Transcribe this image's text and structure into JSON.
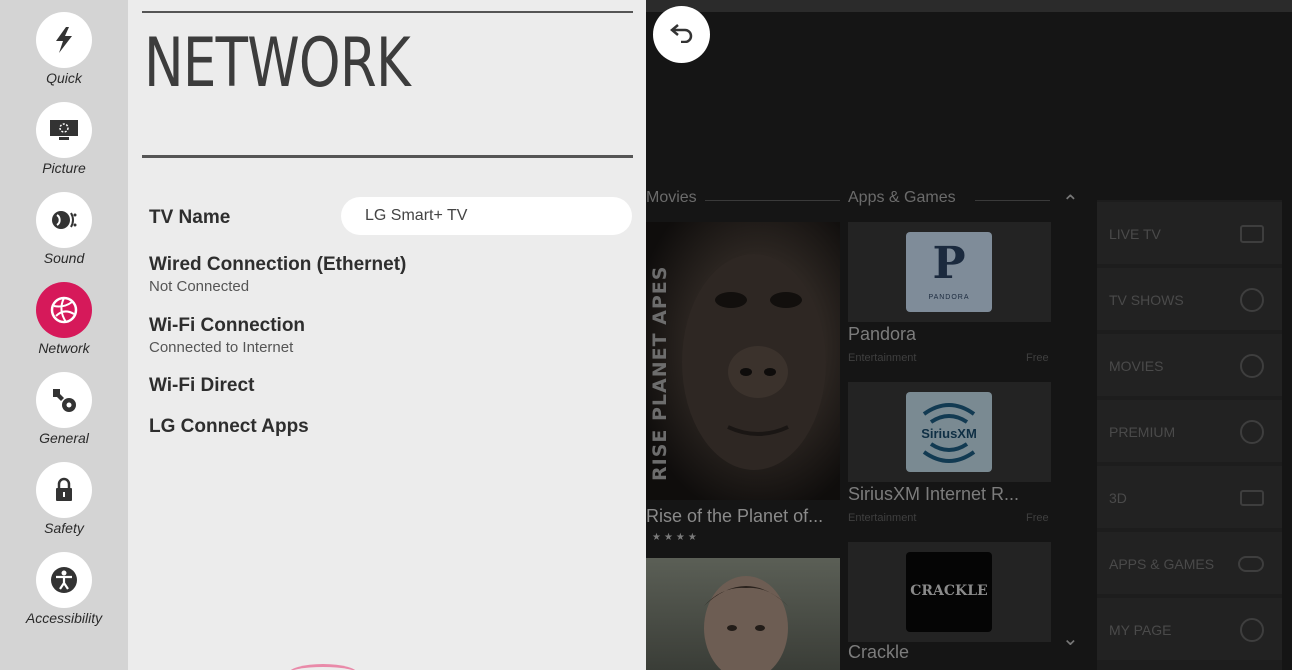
{
  "rail": {
    "items": [
      {
        "label": "Quick",
        "icon": "lightning-icon"
      },
      {
        "label": "Picture",
        "icon": "picture-icon"
      },
      {
        "label": "Sound",
        "icon": "sound-icon"
      },
      {
        "label": "Network",
        "icon": "globe-icon",
        "active": true
      },
      {
        "label": "General",
        "icon": "wrench-gear-icon"
      },
      {
        "label": "Safety",
        "icon": "lock-icon"
      },
      {
        "label": "Accessibility",
        "icon": "accessibility-icon"
      }
    ],
    "active_color": "#d6195a"
  },
  "panel": {
    "title": "NETWORK",
    "tv_name": {
      "label": "TV Name",
      "value": "LG Smart+ TV"
    },
    "wired": {
      "label": "Wired Connection (Ethernet)",
      "status": "Not Connected"
    },
    "wifi": {
      "label": "Wi-Fi Connection",
      "status": "Connected to Internet"
    },
    "wifi_direct": {
      "label": "Wi-Fi Direct"
    },
    "lg_connect": {
      "label": "LG Connect Apps"
    }
  },
  "background": {
    "movies_title": "Movies",
    "apps_title": "Apps & Games",
    "movie": {
      "title": "Rise of the Planet of...",
      "poster_text": "RISE PLANET APES",
      "stars": "★★★★"
    },
    "apps": [
      {
        "name": "Pandora",
        "category": "Entertainment",
        "price": "Free",
        "logo_text": "P",
        "logo_sub": "PANDORA"
      },
      {
        "name": "SiriusXM Internet R...",
        "category": "Entertainment",
        "price": "Free",
        "logo_text": "SiriusXM"
      },
      {
        "name": "Crackle",
        "logo_text": "CRACKLE"
      }
    ],
    "nav": [
      {
        "label": "LIVE TV"
      },
      {
        "label": "TV SHOWS"
      },
      {
        "label": "MOVIES"
      },
      {
        "label": "PREMIUM"
      },
      {
        "label": "3D"
      },
      {
        "label": "APPS & GAMES"
      },
      {
        "label": "MY PAGE"
      }
    ]
  }
}
